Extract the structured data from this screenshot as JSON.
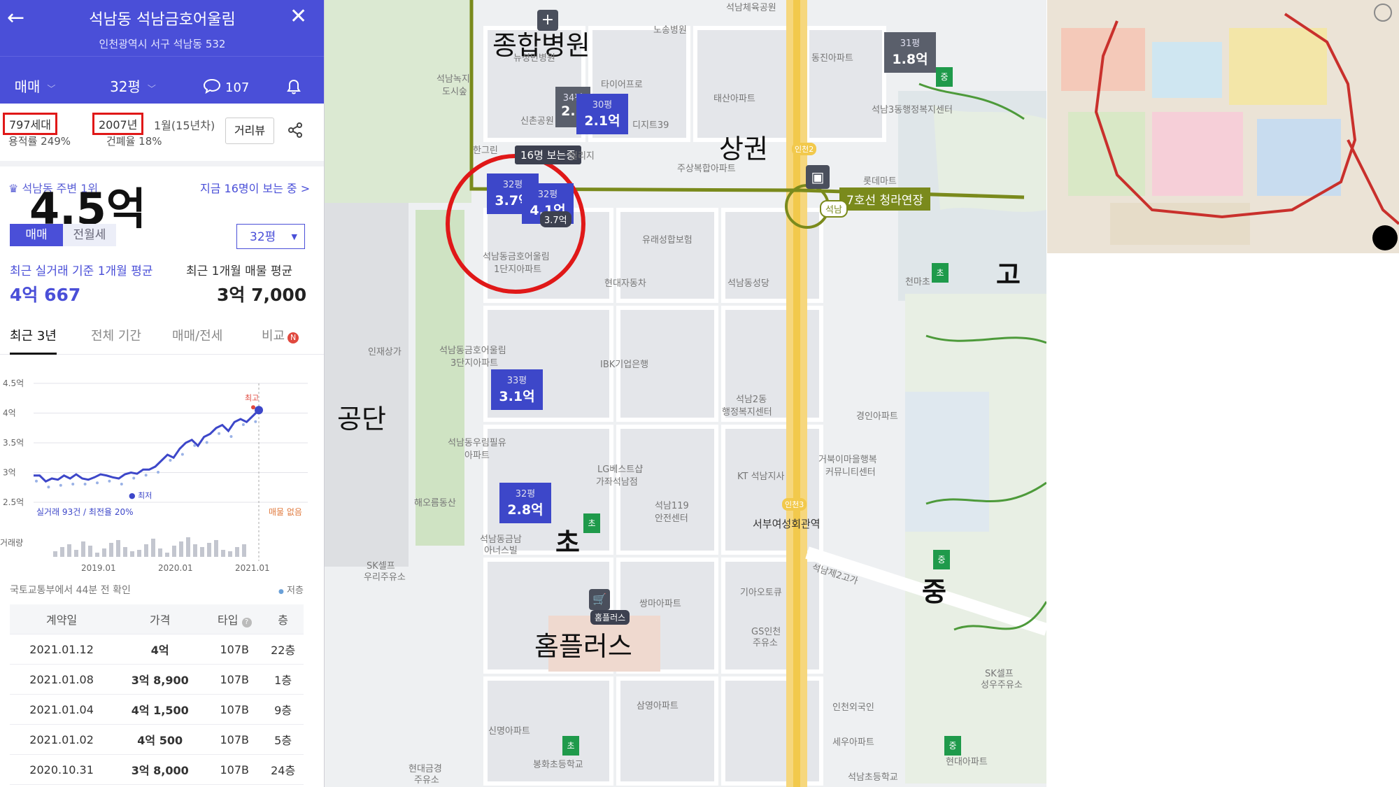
{
  "header": {
    "title": "석남동 석남금호어울림",
    "address": "인천광역시 서구 석남동 532",
    "back_icon": "←",
    "close_icon": "✕"
  },
  "toolbar": {
    "trade_type": "매매",
    "size": "32평",
    "comments_count": "107"
  },
  "summary": {
    "households": "797세대",
    "floor_area_ratio": "용적률 249%",
    "built_year": "2007년",
    "built_month": "1월(15년차)",
    "coverage_ratio": "건폐율 18%",
    "street_view": "거리뷰"
  },
  "ranking": {
    "label": "석남동 주변 1위",
    "watching": "지금 16명이 보는 중 >"
  },
  "overlay_price": "4.5억",
  "filters": {
    "sale_tab": "매매",
    "rent_tab": "전월세",
    "size_select": "32평"
  },
  "averages": {
    "recent_label": "최근 실거래 기준 1개월 평균",
    "recent_value": "4억 667",
    "listing_label": "최근 1개월 매물 평균",
    "listing_value": "3억 7,000"
  },
  "period_tabs": [
    "최근 3년",
    "전체 기간",
    "매매/전세",
    "비교"
  ],
  "chart_data": {
    "type": "line",
    "y_ticks": [
      "4.5억",
      "4억",
      "3.5억",
      "3억",
      "2.5억"
    ],
    "ylim": [
      2.5,
      4.5
    ],
    "x_ticks": [
      "2019.01",
      "2020.01",
      "2021.01"
    ],
    "series": [
      {
        "values": [
          2.95,
          2.95,
          2.85,
          2.9,
          2.88,
          2.95,
          2.9,
          2.97,
          2.9,
          2.88,
          2.92,
          2.97,
          2.95,
          2.92,
          2.9,
          2.97,
          3.0,
          2.98,
          3.05,
          3.05,
          3.1,
          3.2,
          3.3,
          3.25,
          3.4,
          3.5,
          3.55,
          3.45,
          3.6,
          3.65,
          3.75,
          3.8,
          3.7,
          3.85,
          3.9,
          3.85,
          3.95,
          4.05
        ]
      }
    ],
    "max_marker": "최고",
    "min_marker": "최저",
    "footer_left": "실거래 93건 / 최전율 20%",
    "footer_right": "매물 없음",
    "volume_label": "거래량"
  },
  "source_note": "국토교통부에서 44분 전 확인",
  "sort_label": "저층",
  "deals": {
    "headers": [
      "계약일",
      "가격",
      "타입",
      "층"
    ],
    "rows": [
      {
        "date": "2021.01.12",
        "price": "4억",
        "type": "107B",
        "floor": "22층"
      },
      {
        "date": "2021.01.08",
        "price": "3억 8,900",
        "type": "107B",
        "floor": "1층"
      },
      {
        "date": "2021.01.04",
        "price": "4억 1,500",
        "type": "107B",
        "floor": "9층"
      },
      {
        "date": "2021.01.02",
        "price": "4억 500",
        "type": "107B",
        "floor": "5층"
      },
      {
        "date": "2020.10.31",
        "price": "3억 8,000",
        "type": "107B",
        "floor": "24층"
      }
    ]
  },
  "map": {
    "annotations": {
      "hospital": "종합병원",
      "commercial": "상권",
      "industrial": "공단",
      "elementary": "초",
      "homeplus": "홈플러스",
      "high": "고",
      "middle": "중"
    },
    "viewers_bubble": "16명 보는중",
    "line7_label": "7호선 청라연장",
    "store_tag": "홈플러스",
    "markers": [
      {
        "size": "32평",
        "price": "3.7억"
      },
      {
        "size": "32평",
        "price": "4.1억"
      },
      {
        "size": "34평",
        "price": "2.1"
      },
      {
        "size": "30평",
        "price": "2.1억"
      },
      {
        "size": "31평",
        "price": "1.8억"
      },
      {
        "size": "33평",
        "price": "3.1억"
      },
      {
        "size": "32평",
        "price": "2.8억"
      }
    ],
    "small_tag": "3.7억",
    "place_labels": [
      "석남체육공원",
      "노송병원",
      "뉴성민병원",
      "신촌공원",
      "타이어프로",
      "디지트39",
      "태산아파트",
      "동진아파트",
      "석남녹지",
      "도시숲",
      "한그린",
      "빌리지",
      "주상복합아파트",
      "롯데마트",
      "유래성합보험",
      "석남동금호어울림",
      "1단지아파트",
      "현대자동차",
      "석남동성당",
      "석남3동행정복지센터",
      "인재상가",
      "석남동금호어울림",
      "3단지아파트",
      "IBK기업은행",
      "석남2동",
      "행정복지센터",
      "경인아파트",
      "석남동우림필유",
      "아파트",
      "LG베스트샵",
      "가좌석남점",
      "KT 석남지사",
      "거북이마을행복",
      "커뮤니티센터",
      "해오름동산",
      "석남119",
      "안전센터",
      "서부여성회관역",
      "석남동금남",
      "아너스빌",
      "SK셀프",
      "우리주유소",
      "석남제2고가",
      "쌍마아파트",
      "기아오토큐",
      "GS인천",
      "주유소",
      "삼영아파트",
      "신명아파트",
      "봉화초등학교",
      "세우아파트",
      "현대금경",
      "주유소",
      "SK셀프",
      "성우주유소",
      "석남초등학교",
      "현대아파트",
      "인천외국인",
      "천마초"
    ],
    "station_labels": [
      "인천2",
      "석남",
      "인천3"
    ]
  },
  "colors": {
    "brand": "#4a4fd8",
    "highlight_red": "#e01818",
    "marker_blue": "#3d47c9",
    "marker_gray": "#5a5f6b",
    "line7": "#7a8a1c",
    "road_yellow": "#f2c94c"
  }
}
